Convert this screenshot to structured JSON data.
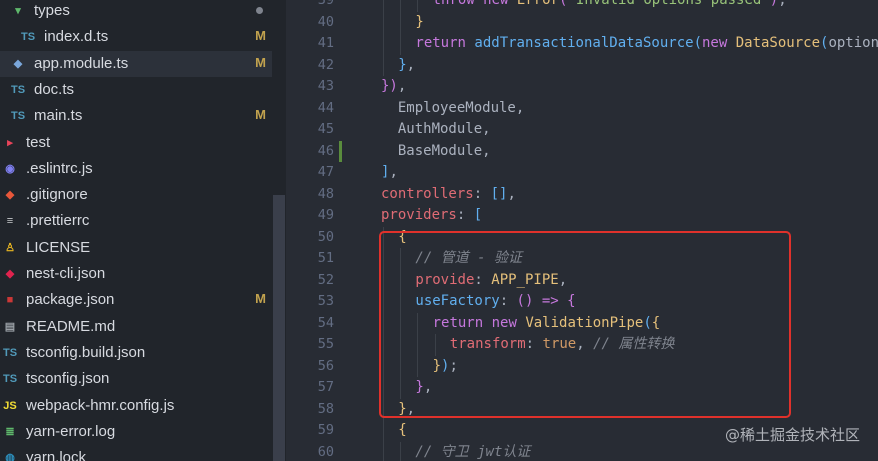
{
  "explorer": {
    "items": [
      {
        "name": "types",
        "icon": "folder-icon",
        "glyph": "▾",
        "color": "#5fb96c",
        "status": "dot",
        "indent": 10,
        "selected": false
      },
      {
        "name": "index.d.ts",
        "icon": "typescript-icon",
        "glyph": "TS",
        "color": "#519aba",
        "status": "M",
        "indent": 20,
        "selected": false
      },
      {
        "name": "app.module.ts",
        "icon": "nest-module-icon",
        "glyph": "◆",
        "color": "#7aa6da",
        "status": "M",
        "indent": 10,
        "selected": true
      },
      {
        "name": "doc.ts",
        "icon": "typescript-icon",
        "glyph": "TS",
        "color": "#519aba",
        "status": "",
        "indent": 10,
        "selected": false
      },
      {
        "name": "main.ts",
        "icon": "typescript-icon",
        "glyph": "TS",
        "color": "#519aba",
        "status": "M",
        "indent": 10,
        "selected": false
      },
      {
        "name": "test",
        "icon": "test-folder-icon",
        "glyph": "▸",
        "color": "#e8445a",
        "status": "",
        "indent": 2,
        "selected": false
      },
      {
        "name": ".eslintrc.js",
        "icon": "eslint-icon",
        "glyph": "◉",
        "color": "#8080f2",
        "status": "",
        "indent": 2,
        "selected": false
      },
      {
        "name": ".gitignore",
        "icon": "git-icon",
        "glyph": "◆",
        "color": "#e8573a",
        "status": "",
        "indent": 2,
        "selected": false
      },
      {
        "name": ".prettierrc",
        "icon": "prettier-icon",
        "glyph": "≡",
        "color": "#c7c9cc",
        "status": "",
        "indent": 2,
        "selected": false
      },
      {
        "name": "LICENSE",
        "icon": "license-icon",
        "glyph": "♙",
        "color": "#e6b422",
        "status": "",
        "indent": 2,
        "selected": false
      },
      {
        "name": "nest-cli.json",
        "icon": "nest-icon",
        "glyph": "◆",
        "color": "#e0234e",
        "status": "",
        "indent": 2,
        "selected": false
      },
      {
        "name": "package.json",
        "icon": "npm-icon",
        "glyph": "■",
        "color": "#cb3837",
        "status": "M",
        "indent": 2,
        "selected": false
      },
      {
        "name": "README.md",
        "icon": "markdown-icon",
        "glyph": "▤",
        "color": "#9aa0a6",
        "status": "",
        "indent": 2,
        "selected": false
      },
      {
        "name": "tsconfig.build.json",
        "icon": "tsconfig-icon",
        "glyph": "TS",
        "color": "#519aba",
        "status": "",
        "indent": 2,
        "selected": false
      },
      {
        "name": "tsconfig.json",
        "icon": "tsconfig-icon",
        "glyph": "TS",
        "color": "#519aba",
        "status": "",
        "indent": 2,
        "selected": false
      },
      {
        "name": "webpack-hmr.config.js",
        "icon": "javascript-icon",
        "glyph": "JS",
        "color": "#f1dd35",
        "status": "",
        "indent": 2,
        "selected": false
      },
      {
        "name": "yarn-error.log",
        "icon": "log-icon",
        "glyph": "≣",
        "color": "#5fb96c",
        "status": "",
        "indent": 2,
        "selected": false
      },
      {
        "name": "yarn.lock",
        "icon": "yarn-icon",
        "glyph": "◍",
        "color": "#2c8ebb",
        "status": "",
        "indent": 2,
        "selected": false
      }
    ]
  },
  "editor": {
    "lines": [
      {
        "n": "39",
        "ind": 3,
        "t": [
          [
            "k",
            "throw "
          ],
          [
            "k",
            "new "
          ],
          [
            "cls",
            "Error"
          ],
          [
            "b2",
            "("
          ],
          [
            "str",
            "'Invalid options passed'"
          ],
          [
            "b2",
            ")"
          ],
          [
            "pl",
            ";"
          ]
        ]
      },
      {
        "n": "40",
        "ind": 2,
        "t": [
          [
            "b1",
            "}"
          ]
        ]
      },
      {
        "n": "41",
        "ind": 2,
        "t": [
          [
            "k",
            "return "
          ],
          [
            "fn",
            "addTransactionalDataSource"
          ],
          [
            "b3",
            "("
          ],
          [
            "k",
            "new "
          ],
          [
            "cls",
            "DataSource"
          ],
          [
            "b3",
            "("
          ],
          [
            "pl",
            "options"
          ]
        ]
      },
      {
        "n": "42",
        "ind": 1,
        "t": [
          [
            "b3",
            "}"
          ],
          [
            "pl",
            ","
          ]
        ]
      },
      {
        "n": "43",
        "ind": 0,
        "t": [
          [
            "b2",
            "})"
          ],
          [
            "pl",
            ","
          ]
        ]
      },
      {
        "n": "44",
        "ind": 0,
        "t": [
          [
            "pl",
            "  EmployeeModule,"
          ]
        ]
      },
      {
        "n": "45",
        "ind": 0,
        "t": [
          [
            "pl",
            "  AuthModule,"
          ]
        ]
      },
      {
        "n": "46",
        "ind": 0,
        "t": [
          [
            "pl",
            "  BaseModule,"
          ]
        ]
      },
      {
        "n": "47",
        "ind": 0,
        "t": [
          [
            "b3",
            "]"
          ],
          [
            "pl",
            ","
          ]
        ]
      },
      {
        "n": "48",
        "ind": 0,
        "t": [
          [
            "prop",
            "controllers"
          ],
          [
            "pl",
            ": "
          ],
          [
            "b3",
            "[]"
          ],
          [
            "pl",
            ","
          ]
        ]
      },
      {
        "n": "49",
        "ind": 0,
        "t": [
          [
            "prop",
            "providers"
          ],
          [
            "pl",
            ": "
          ],
          [
            "b3",
            "["
          ]
        ]
      },
      {
        "n": "50",
        "ind": 1,
        "t": [
          [
            "b1",
            "{"
          ]
        ]
      },
      {
        "n": "51",
        "ind": 2,
        "t": [
          [
            "cm",
            "// 管道 - 验证"
          ]
        ]
      },
      {
        "n": "52",
        "ind": 2,
        "t": [
          [
            "prop",
            "provide"
          ],
          [
            "pl",
            ": "
          ],
          [
            "cls",
            "APP_PIPE"
          ],
          [
            "pl",
            ","
          ]
        ]
      },
      {
        "n": "53",
        "ind": 2,
        "t": [
          [
            "fn",
            "useFactory"
          ],
          [
            "pl",
            ": "
          ],
          [
            "b2",
            "()"
          ],
          [
            "k",
            " => "
          ],
          [
            "b2",
            "{"
          ]
        ]
      },
      {
        "n": "54",
        "ind": 3,
        "t": [
          [
            "k",
            "return "
          ],
          [
            "k",
            "new "
          ],
          [
            "cls",
            "ValidationPipe"
          ],
          [
            "b3",
            "("
          ],
          [
            "b1",
            "{"
          ]
        ]
      },
      {
        "n": "55",
        "ind": 4,
        "t": [
          [
            "prop",
            "transform"
          ],
          [
            "pl",
            ": "
          ],
          [
            "num",
            "true"
          ],
          [
            "pl",
            ", "
          ],
          [
            "cm",
            "// 属性转换"
          ]
        ]
      },
      {
        "n": "56",
        "ind": 3,
        "t": [
          [
            "b1",
            "}"
          ],
          [
            "b3",
            ")"
          ],
          [
            "pl",
            ";"
          ]
        ]
      },
      {
        "n": "57",
        "ind": 2,
        "t": [
          [
            "b2",
            "}"
          ],
          [
            "pl",
            ","
          ]
        ]
      },
      {
        "n": "58",
        "ind": 1,
        "t": [
          [
            "b1",
            "}"
          ],
          [
            "pl",
            ","
          ]
        ]
      },
      {
        "n": "59",
        "ind": 1,
        "t": [
          [
            "b1",
            "{"
          ]
        ]
      },
      {
        "n": "60",
        "ind": 2,
        "t": [
          [
            "cm",
            "// 守卫 jwt认证"
          ]
        ]
      }
    ]
  },
  "watermark": "@稀土掘金技术社区"
}
